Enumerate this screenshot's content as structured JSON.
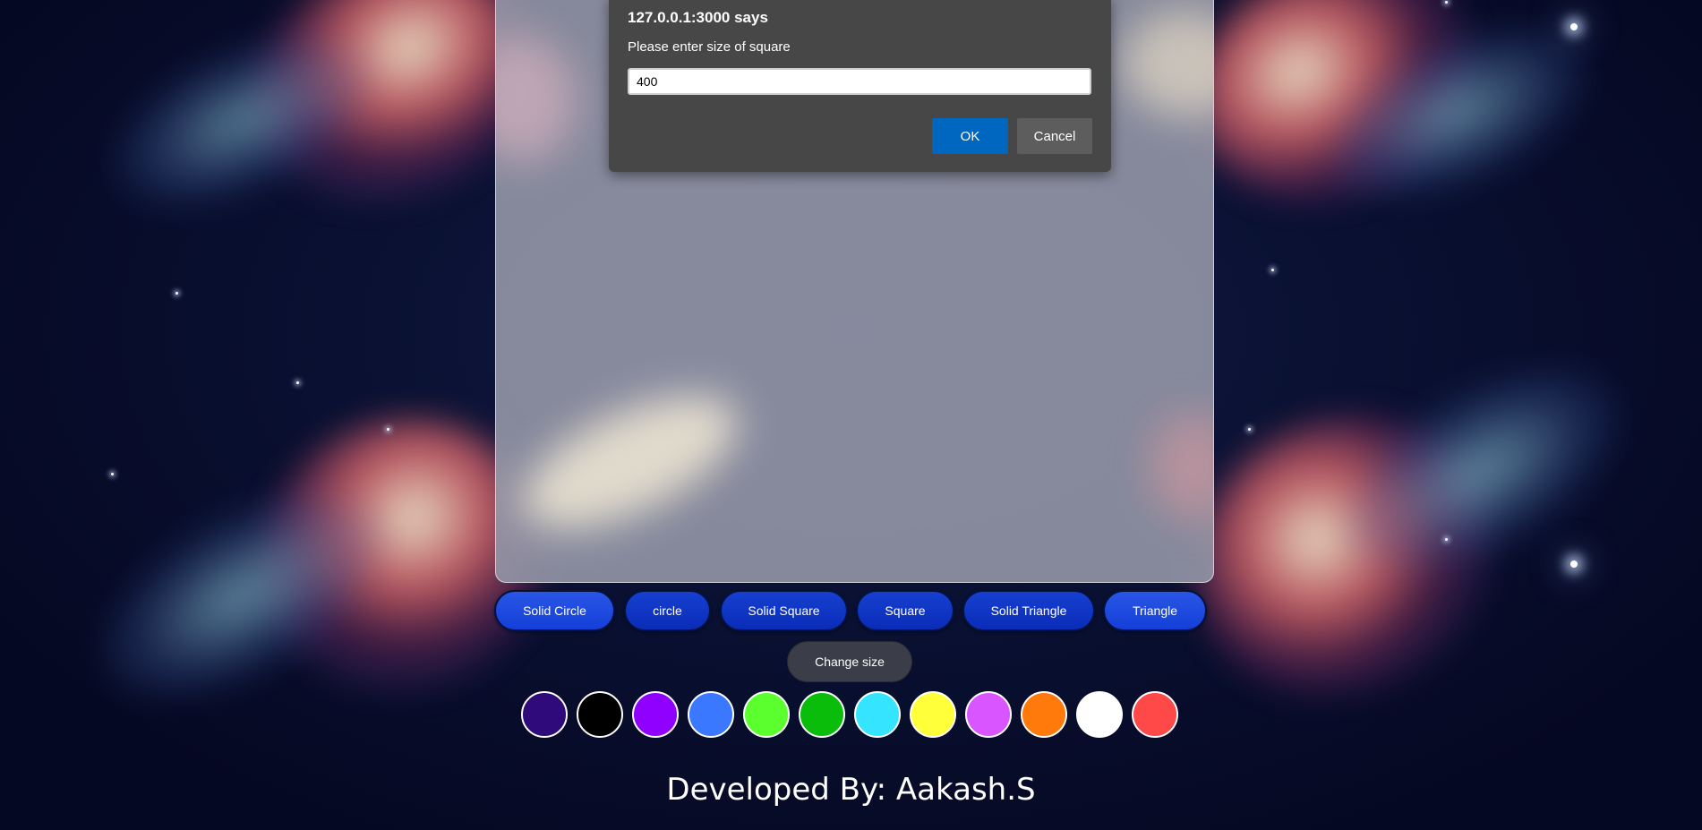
{
  "dialog": {
    "title": "127.0.0.1:3000 says",
    "message": "Please enter size of square",
    "input_value": "400",
    "ok_label": "OK",
    "cancel_label": "Cancel"
  },
  "shapes": {
    "solid_circle": "Solid Circle",
    "circle": "circle",
    "solid_square": "Solid Square",
    "square": "Square",
    "solid_triangle": "Solid Triangle",
    "triangle": "Triangle"
  },
  "change_size_label": "Change size",
  "palette": [
    {
      "name": "indigo",
      "color": "#2e0a7a"
    },
    {
      "name": "black",
      "color": "#000000"
    },
    {
      "name": "violet",
      "color": "#9000ff"
    },
    {
      "name": "blue",
      "color": "#3a78ff"
    },
    {
      "name": "lime",
      "color": "#5cff2e"
    },
    {
      "name": "green",
      "color": "#0bbd0b"
    },
    {
      "name": "cyan",
      "color": "#35e5ff"
    },
    {
      "name": "yellow",
      "color": "#ffff3a"
    },
    {
      "name": "magenta",
      "color": "#d955ff"
    },
    {
      "name": "orange",
      "color": "#ff7a0a"
    },
    {
      "name": "white",
      "color": "#ffffff"
    },
    {
      "name": "red",
      "color": "#ff4848"
    }
  ],
  "footer": "Developed By: Aakash.S",
  "colors": {
    "dialog_bg": "#474747",
    "ok_button": "#0067c0",
    "shape_button": "#0a2cb8",
    "size_button": "#3b3d48"
  }
}
